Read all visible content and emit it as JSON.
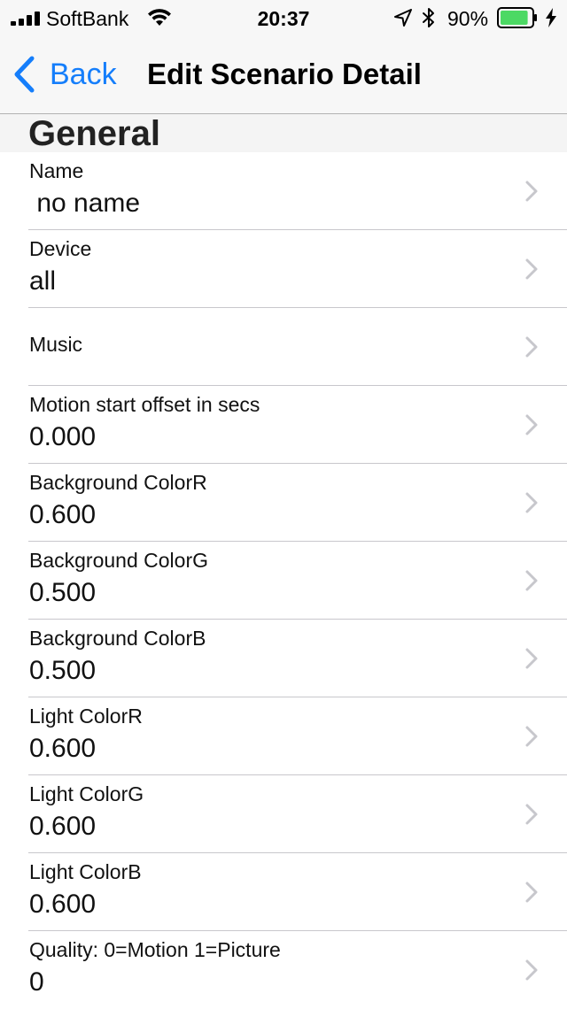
{
  "status_bar": {
    "carrier": "SoftBank",
    "time": "20:37",
    "battery_percent": "90%",
    "battery_level": 0.9,
    "icons": [
      "signal-icon",
      "wifi-icon",
      "location-arrow-icon",
      "bluetooth-icon",
      "battery-icon",
      "charging-bolt-icon"
    ]
  },
  "nav": {
    "back_label": "Back",
    "title": "Edit Scenario Detail",
    "accent_color": "#157efb"
  },
  "section": {
    "title": "General"
  },
  "rows": [
    {
      "label": "Name",
      "value": " no name"
    },
    {
      "label": "Device",
      "value": "all"
    },
    {
      "label": "Music",
      "value": ""
    },
    {
      "label": "Motion start offset in secs",
      "value": "0.000"
    },
    {
      "label": "Background ColorR",
      "value": "0.600"
    },
    {
      "label": "Background ColorG",
      "value": "0.500"
    },
    {
      "label": "Background ColorB",
      "value": "0.500"
    },
    {
      "label": "Light ColorR",
      "value": "0.600"
    },
    {
      "label": "Light ColorG",
      "value": "0.600"
    },
    {
      "label": "Light ColorB",
      "value": "0.600"
    },
    {
      "label": "Quality: 0=Motion 1=Picture",
      "value": "0"
    }
  ]
}
